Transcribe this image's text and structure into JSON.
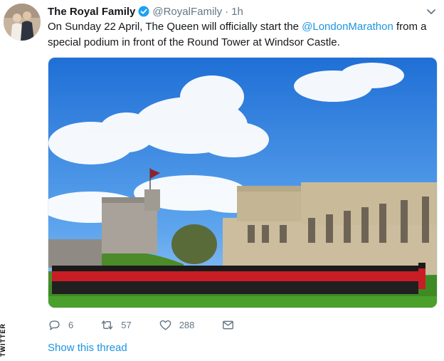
{
  "tweet": {
    "display_name": "The Royal Family",
    "handle": "@RoyalFamily",
    "separator": "·",
    "time": "1h",
    "text_before": "On Sunday 22 April, The Queen will officially start the ",
    "mention": "@LondonMarathon",
    "text_after": " from a special podium in front of the Round Tower at Windsor Castle."
  },
  "actions": {
    "reply_count": "6",
    "retweet_count": "57",
    "like_count": "288"
  },
  "thread_link": "Show this thread",
  "watermark": "TWITTER",
  "colors": {
    "link": "#1b95e0",
    "muted": "#657786",
    "text": "#14171a",
    "verified": "#1da1f2"
  },
  "icons": [
    "verified-badge-icon",
    "chevron-down-icon",
    "reply-icon",
    "retweet-icon",
    "like-icon",
    "dm-icon"
  ]
}
